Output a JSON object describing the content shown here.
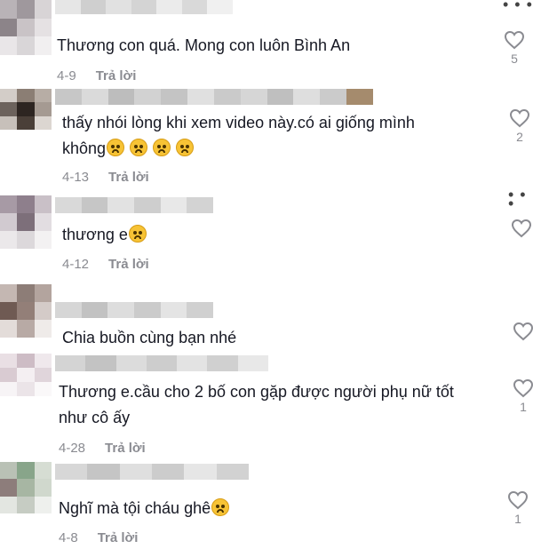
{
  "reply_label": "Trả lời",
  "comments": [
    {
      "text": "Thương con quá. Mong con luôn Bình An",
      "date": "4-9",
      "likes": "5",
      "emoji_count": 0
    },
    {
      "text": "thấy nhói lòng khi xem video này.có ai giống mình",
      "text2": "không",
      "date": "4-13",
      "likes": "2",
      "emoji_count": 4
    },
    {
      "text": "thương e",
      "date": "4-12",
      "likes": "",
      "emoji_count": 1
    },
    {
      "text": "Chia buồn cùng bạn nhé",
      "date": "",
      "likes": "",
      "emoji_count": 0
    },
    {
      "text": "Thương e.cầu cho 2 bố con gặp được người phụ nữ tốt",
      "text2": "như cô ấy",
      "date": "4-28",
      "likes": "1",
      "emoji_count": 0
    },
    {
      "text": "Nghĩ mà tội cháu ghê",
      "date": "4-8",
      "likes": "1",
      "emoji_count": 1
    }
  ],
  "colors": {
    "text": "#161823",
    "meta": "#8a8b91",
    "heart": "#8a8b91",
    "emoji": "#f7c335"
  },
  "icons": {
    "like": "heart-outline-icon",
    "more": "ellipsis-icon",
    "emoji": "worried-face-emoji"
  }
}
